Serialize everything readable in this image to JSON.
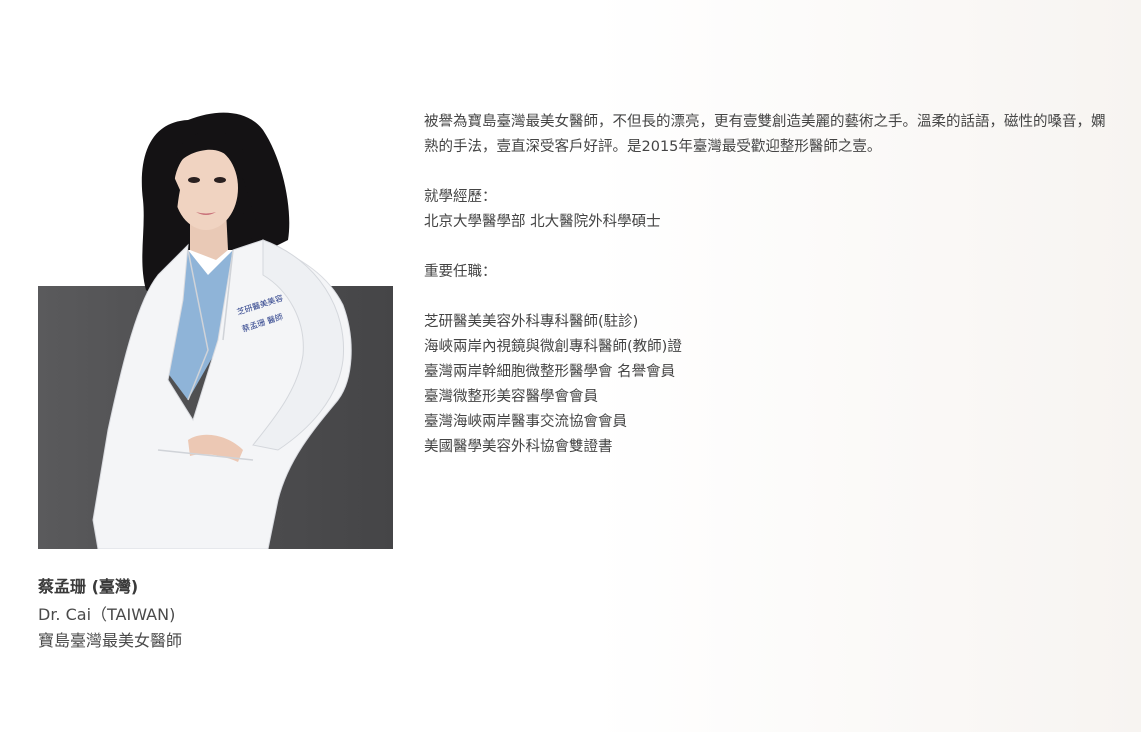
{
  "profile": {
    "name": "蔡孟珊 (臺灣)",
    "name_en": "Dr. Cai（TAIWAN)",
    "subtitle": "寶島臺灣最美女醫師",
    "coat_embroidery": [
      "芝研醫美美容",
      "蔡孟珊  醫師"
    ]
  },
  "bio": {
    "intro": "被譽為寶島臺灣最美女醫師，不但長的漂亮，更有壹雙創造美麗的藝術之手。溫柔的話語，磁性的嗓音，嫻熟的手法，壹直深受客戶好評。是2015年臺灣最受歡迎整形醫師之壹。",
    "education_heading": "就學經歷：",
    "education": "北京大學醫學部  北大醫院外科學碩士",
    "positions_heading": "重要任職：",
    "positions": [
      "芝研醫美美容外科專科醫師(駐診)",
      "海峽兩岸內視鏡與微創專科醫師(教師)證",
      "臺灣兩岸幹細胞微整形醫學會  名譽會員",
      "臺灣微整形美容醫學會會員",
      "臺灣海峽兩岸醫事交流協會會員",
      "美國醫學美容外科協會雙證書"
    ]
  },
  "colors": {
    "photo_backdrop": "#4e4e50",
    "coat": "#f4f5f7",
    "scrubs": "#8fb4d8",
    "hair": "#141214",
    "text": "#444444"
  }
}
